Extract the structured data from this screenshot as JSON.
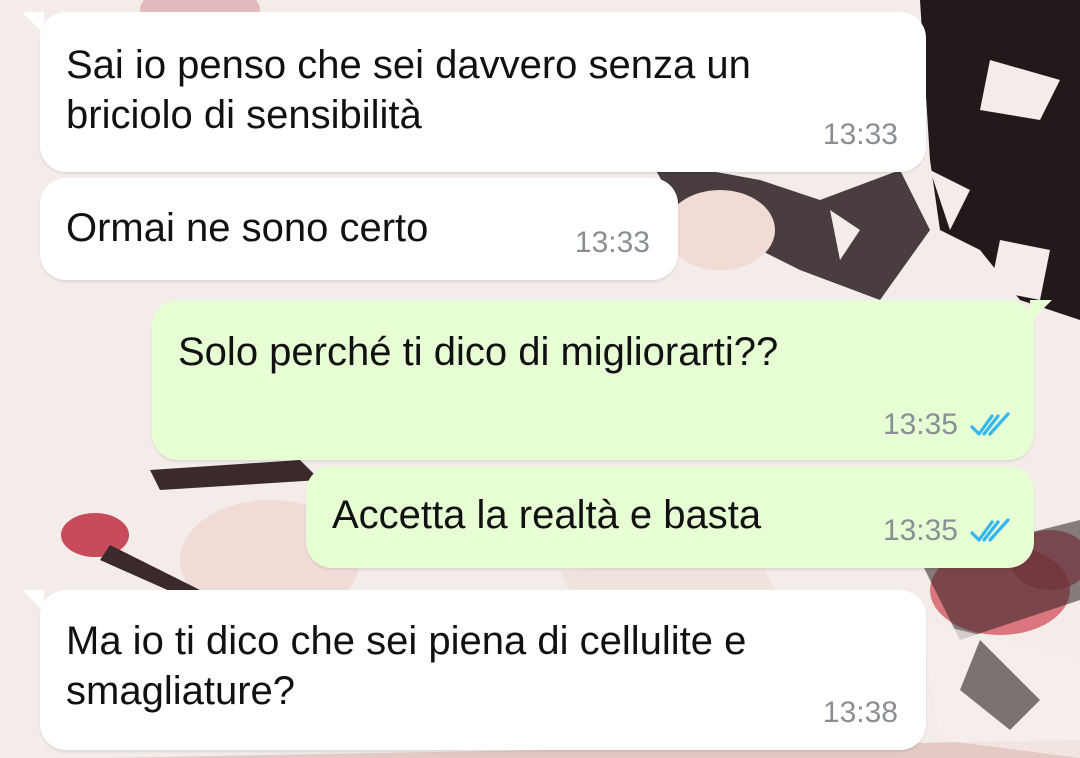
{
  "chat": {
    "messages": [
      {
        "direction": "incoming",
        "text_lines": [
          "Sai io penso che sei davvero senza un",
          "briciolo di sensibilità"
        ],
        "time": "13:33"
      },
      {
        "direction": "incoming",
        "text_lines": [
          "Ormai ne sono certo"
        ],
        "time": "13:33"
      },
      {
        "direction": "outgoing",
        "text_lines": [
          "Solo perché ti dico di migliorarti??"
        ],
        "time": "13:35",
        "status_icon": "double-check-read-icon"
      },
      {
        "direction": "outgoing",
        "text_lines": [
          "Accetta la realtà e basta"
        ],
        "time": "13:35",
        "status_icon": "double-check-read-icon"
      },
      {
        "direction": "incoming",
        "text_lines": [
          "Ma io ti dico che sei piena di cellulite e",
          "smagliature?"
        ],
        "time": "13:38"
      }
    ]
  },
  "colors": {
    "incoming_bubble": "#ffffff",
    "outgoing_bubble": "#e7fdd3",
    "read_ticks": "#34b7f1",
    "timestamp": "#8a8f93"
  },
  "wallpaper": "floral-pattern"
}
